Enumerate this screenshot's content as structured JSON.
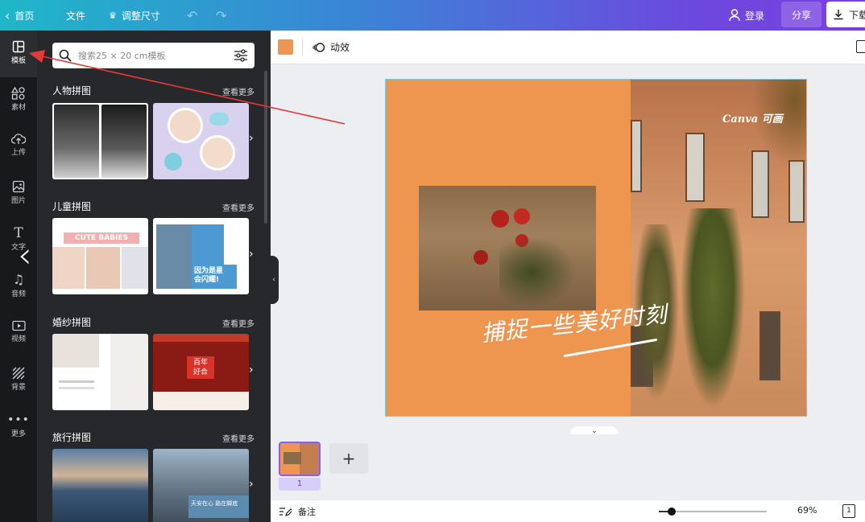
{
  "topbar": {
    "home_label": "首页",
    "file_label": "文件",
    "resize_label": "调整尺寸",
    "login_label": "登录",
    "share_label": "分享",
    "download_label": "下载"
  },
  "rail": {
    "items": [
      {
        "label": "模板",
        "icon": "template-icon"
      },
      {
        "label": "素材",
        "icon": "elements-icon"
      },
      {
        "label": "上传",
        "icon": "upload-icon"
      },
      {
        "label": "图片",
        "icon": "photo-icon"
      },
      {
        "label": "文字",
        "icon": "text-icon"
      },
      {
        "label": "音频",
        "icon": "audio-icon"
      },
      {
        "label": "视频",
        "icon": "video-icon"
      },
      {
        "label": "背景",
        "icon": "background-icon"
      },
      {
        "label": "更多",
        "icon": "more-icon"
      }
    ]
  },
  "panel": {
    "search_placeholder": "搜索25 × 20 cm模板",
    "see_more": "查看更多",
    "sections": [
      {
        "title": "人物拼图"
      },
      {
        "title": "儿童拼图",
        "thumb_text": "CUTE BABIES",
        "thumb_text2": "因为是星\n会闪耀!"
      },
      {
        "title": "婚纱拼图",
        "thumb_text": "百年\n好合"
      },
      {
        "title": "旅行拼图",
        "thumb_text": "天安在心 路在脚底"
      }
    ]
  },
  "toolbar": {
    "color": "#ee9650",
    "animate_label": "动效"
  },
  "canvas": {
    "brand_text": "Canva 可画",
    "caption": "捕捉一些美好时刻",
    "bg_color": "#ee9650"
  },
  "pages": {
    "current_page": "1",
    "add_label": "+"
  },
  "bottom": {
    "notes_label": "备注",
    "zoom": "69%",
    "zoom_fraction": 0.12,
    "page_count": "1"
  },
  "colors": {
    "accent": "#8b5cf6",
    "annotation_arrow": "#e53935"
  }
}
